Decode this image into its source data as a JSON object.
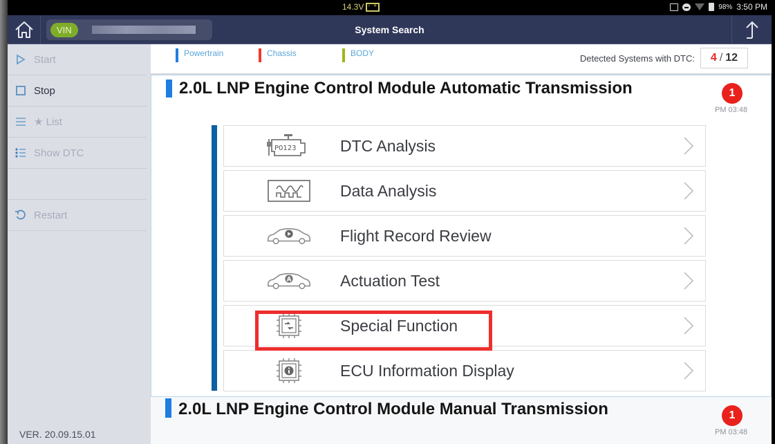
{
  "status_bar": {
    "voltage": "14.3V",
    "battery_percent": "98%",
    "time": "3:50 PM",
    "icons": [
      "car-battery-icon",
      "cast-icon",
      "do-not-disturb-icon",
      "wifi-icon",
      "battery-charging-icon"
    ]
  },
  "header": {
    "home_icon": "home-icon",
    "vin_label": "VIN",
    "vin_value": "",
    "title": "System Search",
    "export_icon": "upload-arrow-icon"
  },
  "sidebar": {
    "items": [
      {
        "label": "Start",
        "icon": "play-icon",
        "enabled": false
      },
      {
        "label": "Stop",
        "icon": "stop-square-icon",
        "enabled": true
      },
      {
        "label": "★ List",
        "icon": "list-icon",
        "enabled": false
      },
      {
        "label": "Show DTC",
        "icon": "bullet-list-icon",
        "enabled": false
      },
      {
        "label": "",
        "icon": "",
        "enabled": false
      },
      {
        "label": "Restart",
        "icon": "restart-icon",
        "enabled": false
      }
    ],
    "version": "VER. 20.09.15.01"
  },
  "filters": [
    {
      "label": "Powertrain",
      "color": "#1e7fe0"
    },
    {
      "label": "Chassis",
      "color": "#ef3b2c"
    },
    {
      "label": "BODY",
      "color": "#9fb51c"
    }
  ],
  "dtc_summary": {
    "label": "Detected Systems with DTC:",
    "detected": "4",
    "separator": "/",
    "total": "12"
  },
  "sections": [
    {
      "title": "2.0L LNP Engine Control Module Automatic Transmission",
      "dtc_count": "1",
      "time": "PM 03:48",
      "menu": [
        {
          "label": "DTC Analysis",
          "icon": "engine-p0123-icon"
        },
        {
          "label": "Data Analysis",
          "icon": "waveform-icon"
        },
        {
          "label": "Flight Record Review",
          "icon": "car-play-icon"
        },
        {
          "label": "Actuation Test",
          "icon": "car-actuation-icon"
        },
        {
          "label": "Special Function",
          "icon": "chip-swap-icon"
        },
        {
          "label": "ECU Information Display",
          "icon": "chip-info-icon"
        }
      ]
    },
    {
      "title": "2.0L LNP Engine Control Module Manual Transmission",
      "dtc_count": "1",
      "time": "PM 03:48"
    }
  ],
  "highlight": {
    "target": "Special Function",
    "color": "#ee2e2e"
  }
}
